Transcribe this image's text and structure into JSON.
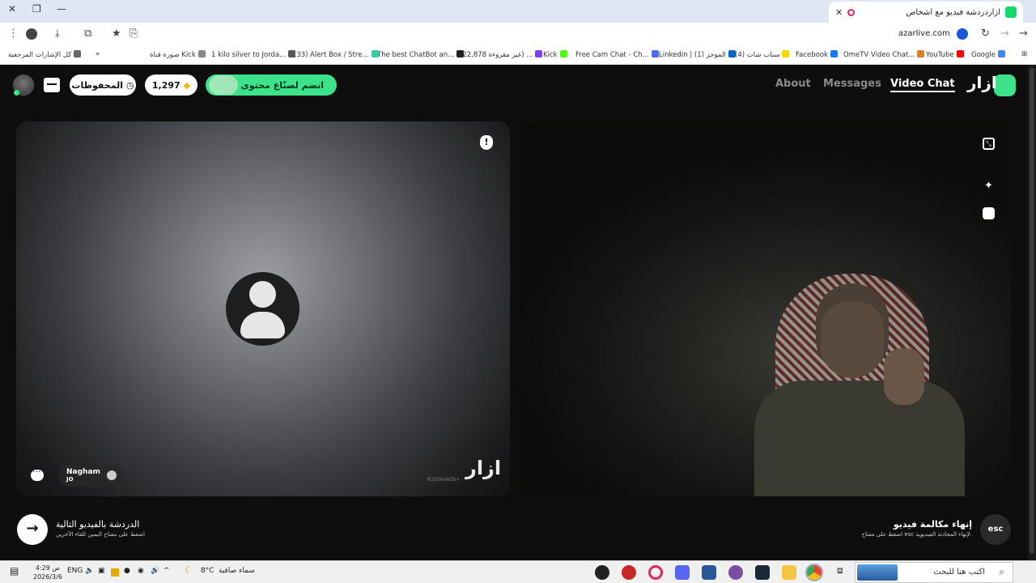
{
  "browser": {
    "tab_title": "أزار‏دردشة فيديو مع أشخاص",
    "url": "azarlive.com",
    "bookmarks": [
      "Google",
      "YouTube",
      "OmeTV Video Chat...",
      "Facebook",
      "(4) سناب شات",
      "LinkedIn | (1) الموجز",
      "Free Cam Chat - Ch...",
      "Kick",
      "(22,878 غير مقروءة) ...",
      "The best ChatBot an...",
      "(33) Alert Box / Stre...",
      "1 kilo silver to Jorda...",
      "صورة قناة Kick",
      "كل الإشارات المرجعية"
    ],
    "bookmark_colors": [
      "#4285f4",
      "#ff0000",
      "#e67e22",
      "#1877f2",
      "#f7d600",
      "#0a66c2",
      "#4a6cf7",
      "#53fc18",
      "#7e3ff2",
      "#222222",
      "#2ad4a6",
      "#555555",
      "#888888",
      "#666666"
    ]
  },
  "header": {
    "logo_text": "ازار",
    "nav": {
      "video_chat": "Video Chat",
      "messages": "Messages",
      "about": "About"
    },
    "join_label": "انضم لصنّاع محتوى ازار",
    "gems": "1,297",
    "saved_label": "المحفوظات"
  },
  "left_pane": {
    "user_name": "Nagham",
    "country_code": "JO",
    "watermark": "ازار",
    "watermark_id": "R1500e6Gb+"
  },
  "bottom": {
    "next_title": "الدردشة بالفيديو التالية",
    "next_sub": "اضغط على مفتاح اليمين للقاء الآخرين",
    "esc_label": "esc",
    "end_title": "إنهاء مكالمة فيديو",
    "end_sub": "اضغط على مفتاح esc لإنهاء المحادثة الفيديوية."
  },
  "taskbar": {
    "time": "4:29 ص",
    "date": "2026/3/6",
    "lang": "ENG",
    "temp": "8°C",
    "weather": "سماء صافية",
    "search_placeholder": "اكتب هنا للبحث"
  },
  "colors": {
    "accent": "#3ce38a",
    "background": "#0e0e0e"
  }
}
